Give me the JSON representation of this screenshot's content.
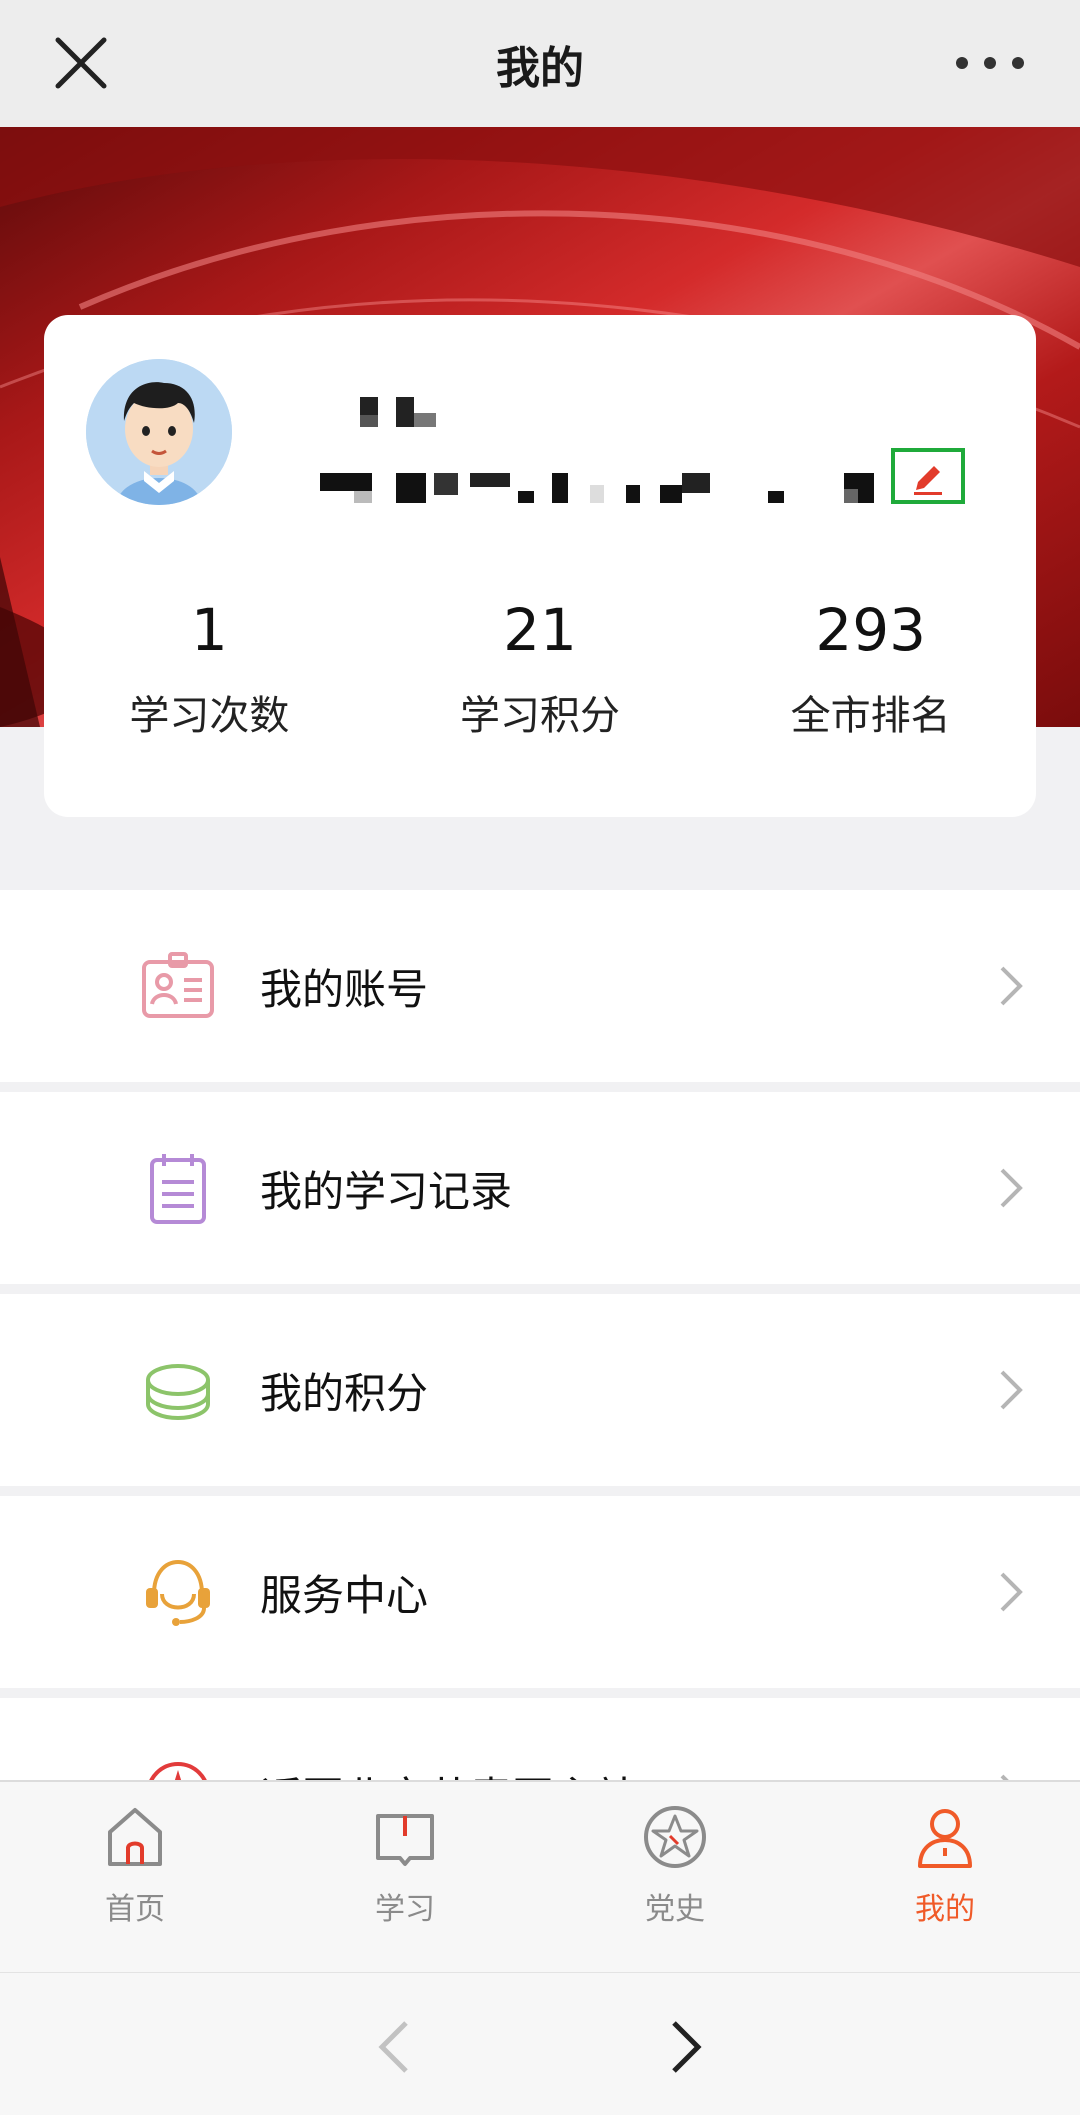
{
  "header": {
    "title": "我的",
    "close_icon": "close-icon",
    "more_icon": "more-icon"
  },
  "profile": {
    "avatar": "avatar-cartoon-boy",
    "edit_icon": "pencil-icon",
    "stats": [
      {
        "value": "1",
        "label": "学习次数"
      },
      {
        "value": "21",
        "label": "学习积分"
      },
      {
        "value": "293",
        "label": "全市排名"
      }
    ]
  },
  "menu": [
    {
      "label": "我的账号",
      "icon": "id-card-icon",
      "color": "#e89aa8"
    },
    {
      "label": "我的学习记录",
      "icon": "notepad-icon",
      "color": "#b58ad6"
    },
    {
      "label": "我的积分",
      "icon": "coin-stack-icon",
      "color": "#8cc46a"
    },
    {
      "label": "服务中心",
      "icon": "headset-icon",
      "color": "#e8a23a"
    },
    {
      "label": "返回北京共青团主站",
      "icon": "compass-icon",
      "color": "#e23b3b"
    }
  ],
  "tabbar": {
    "items": [
      {
        "label": "首页",
        "icon": "home-icon"
      },
      {
        "label": "学习",
        "icon": "book-icon"
      },
      {
        "label": "党史",
        "icon": "star-badge-icon"
      },
      {
        "label": "我的",
        "icon": "user-icon",
        "active": true
      }
    ],
    "active_color": "#f05a28"
  },
  "browser_nav": {
    "back_icon": "chevron-left-icon",
    "forward_icon": "chevron-right-icon"
  }
}
